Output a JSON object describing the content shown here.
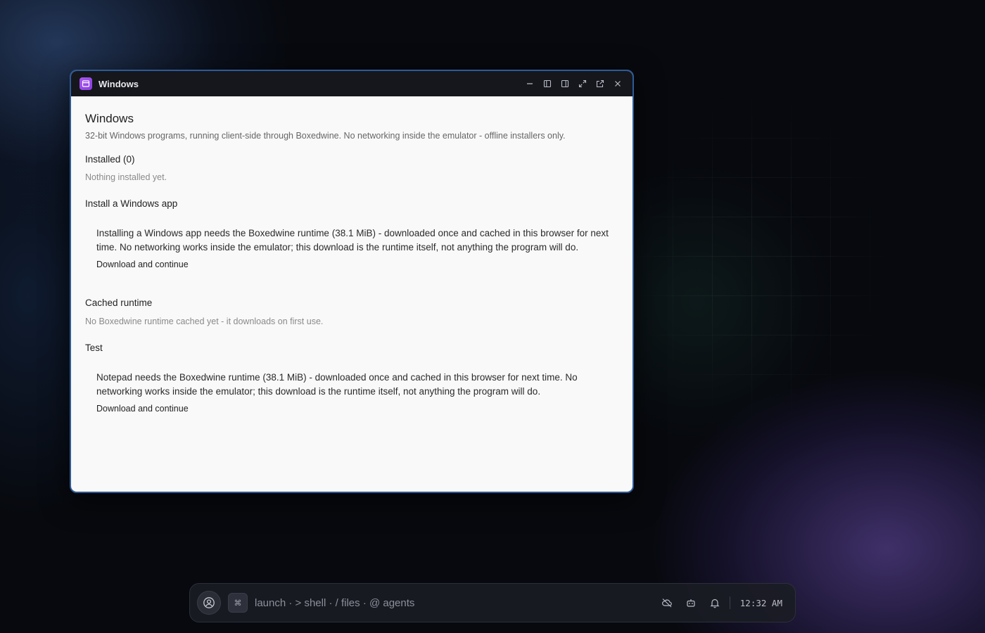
{
  "window": {
    "title": "Windows",
    "app_icon": "windows-app-icon",
    "accent": "#a657f0",
    "controls": [
      "minimize-icon",
      "dock-left-icon",
      "dock-right-icon",
      "maximize-icon",
      "popout-icon",
      "close-icon"
    ]
  },
  "content": {
    "heading": "Windows",
    "description": "32-bit Windows programs, running client-side through Boxedwine. No networking inside the emulator - offline installers only.",
    "installed": {
      "title": "Installed (0)",
      "empty_text": "Nothing installed yet."
    },
    "install": {
      "title": "Install a Windows app",
      "message": "Installing a Windows app needs the Boxedwine runtime (38.1 MiB) - downloaded once and cached in this browser for next time. No networking works inside the emulator; this download is the runtime itself, not anything the program will do.",
      "button": "Download and continue"
    },
    "cached": {
      "title": "Cached runtime",
      "text": "No Boxedwine runtime cached yet - it downloads on first use."
    },
    "test": {
      "title": "Test",
      "message": "Notepad needs the Boxedwine runtime (38.1 MiB) - downloaded once and cached in this browser for next time. No networking works inside the emulator; this download is the runtime itself, not anything the program will do.",
      "button": "Download and continue"
    }
  },
  "taskbar": {
    "command_key": "⌘",
    "hint": "launch · > shell · / files · @ agents",
    "icons": [
      "cloud-off-icon",
      "bot-icon",
      "bell-icon"
    ],
    "clock": "12:32 AM"
  },
  "colors": {
    "window_border": "#2d5a98",
    "titlebar": "#15171c",
    "content_bg": "#f9f9f9"
  }
}
